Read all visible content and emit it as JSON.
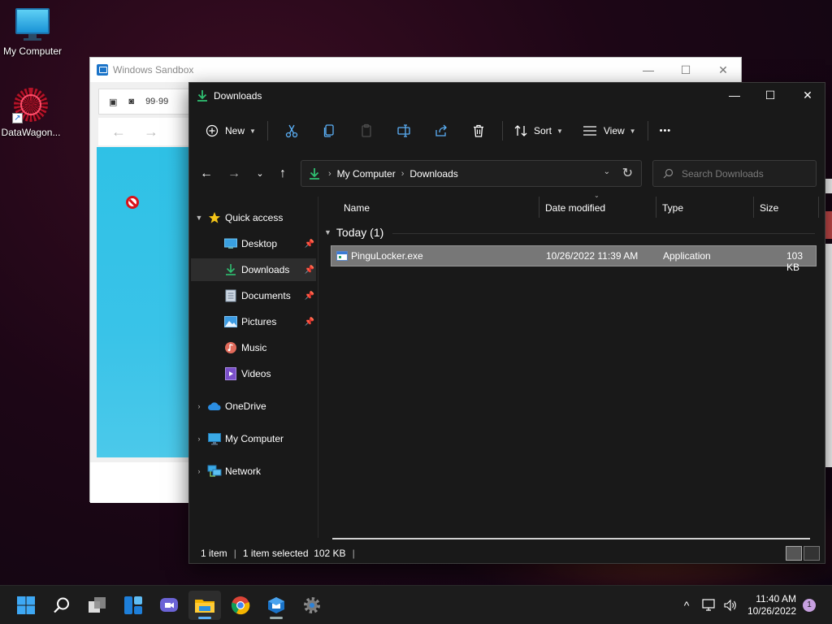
{
  "desktop": {
    "icons": [
      {
        "label": "My Computer",
        "icon": "monitor-icon"
      },
      {
        "label": "DataWagon...",
        "icon": "datawagon-icon"
      }
    ]
  },
  "sandbox": {
    "title": "Windows Sandbox",
    "tab_text": "99·99",
    "controls": {
      "minimize": "—",
      "maximize": "☐",
      "close": "✕"
    }
  },
  "explorer": {
    "title": "Downloads",
    "controls": {
      "minimize": "—",
      "maximize": "☐",
      "close": "✕"
    },
    "toolbar": {
      "new_label": "New",
      "sort_label": "Sort",
      "view_label": "View",
      "more_label": "•••"
    },
    "address": {
      "crumbs": [
        "My Computer",
        "Downloads"
      ]
    },
    "search": {
      "placeholder": "Search Downloads"
    },
    "nav_pane": {
      "quick_access": "Quick access",
      "items": [
        {
          "label": "Desktop",
          "pinned": true
        },
        {
          "label": "Downloads",
          "pinned": true,
          "selected": true
        },
        {
          "label": "Documents",
          "pinned": true
        },
        {
          "label": "Pictures",
          "pinned": true
        },
        {
          "label": "Music",
          "pinned": false
        },
        {
          "label": "Videos",
          "pinned": false
        }
      ],
      "onedrive": "OneDrive",
      "my_computer": "My Computer",
      "network": "Network"
    },
    "columns": {
      "name": "Name",
      "date": "Date modified",
      "type": "Type",
      "size": "Size"
    },
    "group": {
      "label": "Today (1)"
    },
    "files": [
      {
        "name": "PinguLocker.exe",
        "date": "10/26/2022 11:39 AM",
        "type": "Application",
        "size": "103 KB"
      }
    ],
    "status": {
      "count": "1 item",
      "selected": "1 item selected  102 KB"
    }
  },
  "taskbar": {
    "clock_time": "11:40 AM",
    "clock_date": "10/26/2022",
    "notification_count": "1"
  },
  "colors": {
    "accent": "#5bb0f7",
    "download_green": "#2fbf71",
    "selection": "#777777"
  }
}
